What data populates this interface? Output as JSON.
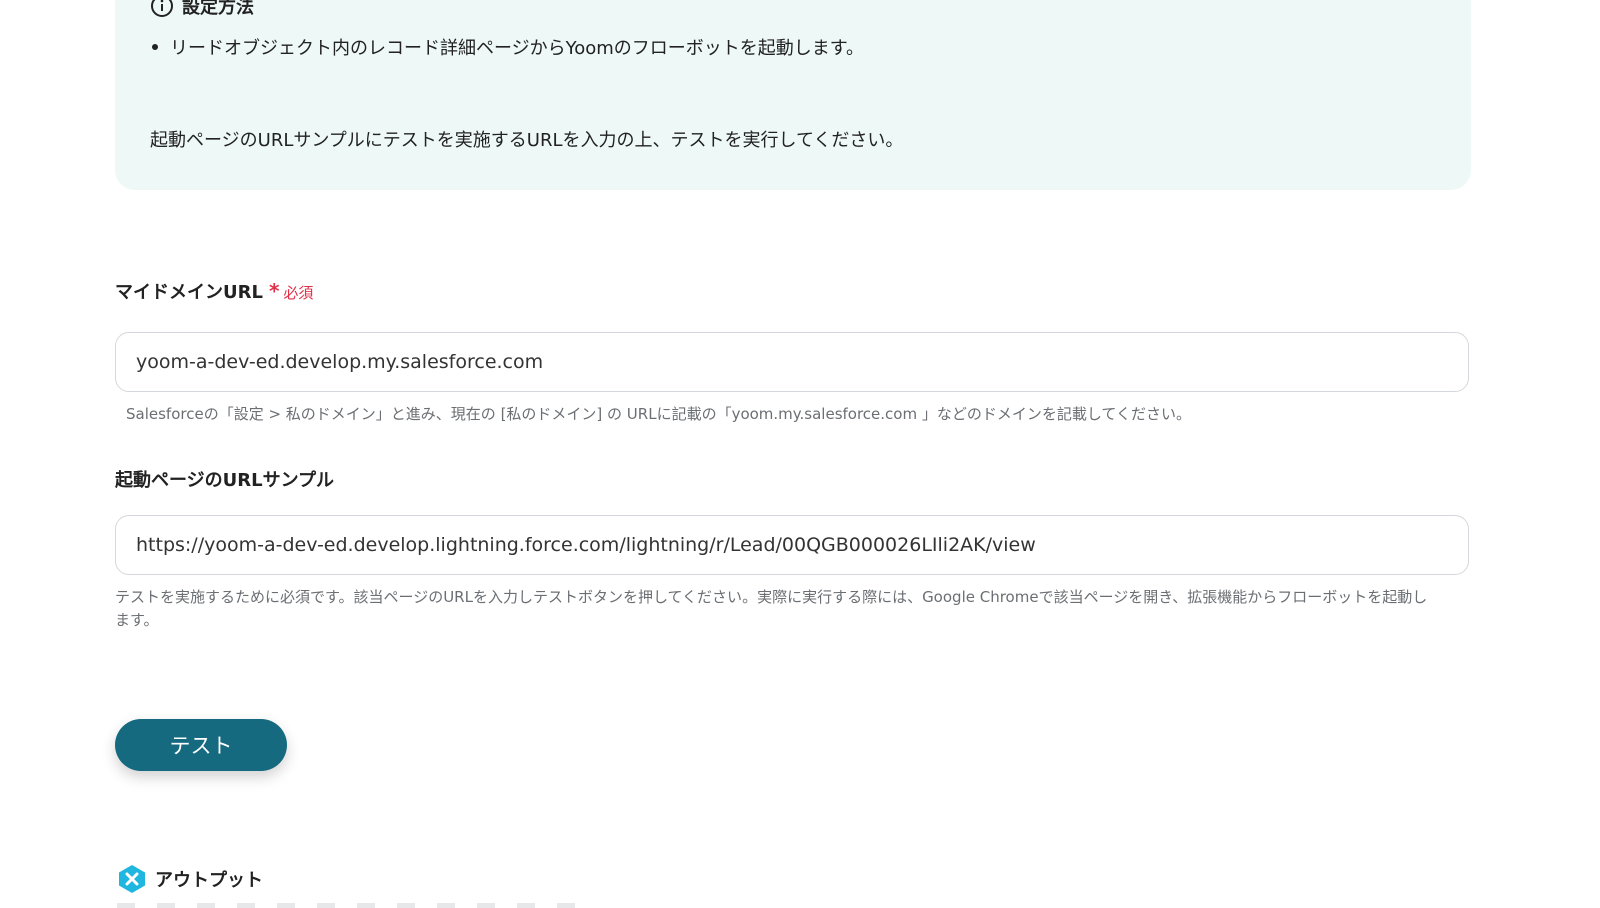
{
  "info": {
    "title": "設定方法",
    "bullet": "リードオブジェクト内のレコード詳細ページからYoomのフローボットを起動します。",
    "note": "起動ページのURLサンプルにテストを実施するURLを入力の上、テストを実行してください。"
  },
  "domain_field": {
    "label": "マイドメインURL",
    "required_mark": "*",
    "required_text": "必須",
    "value": "yoom-a-dev-ed.develop.my.salesforce.com",
    "help": "Salesforceの「設定 > 私のドメイン」と進み、現在の [私のドメイン] の URLに記載の「yoom.my.salesforce.com 」などのドメインを記載してください。"
  },
  "sample_url_field": {
    "label": "起動ページのURLサンプル",
    "value": "https://yoom-a-dev-ed.develop.lightning.force.com/lightning/r/Lead/00QGB000026LIli2AK/view",
    "help_line1": "テストを実施するために必須です。該当ページのURLを入力しテストボタンを押してください。実際に実行する際には、Google Chromeで該当ページを開き、拡張機能からフローボットを起動し",
    "help_line2": "ます。"
  },
  "test_button": {
    "label": "テスト"
  },
  "output": {
    "title": "アウトプット",
    "icon": "output-x-icon"
  },
  "colors": {
    "accent": "#156a80",
    "info_bg": "#eef8f7",
    "required": "#e0314b",
    "output_icon": "#1fb6e0"
  }
}
